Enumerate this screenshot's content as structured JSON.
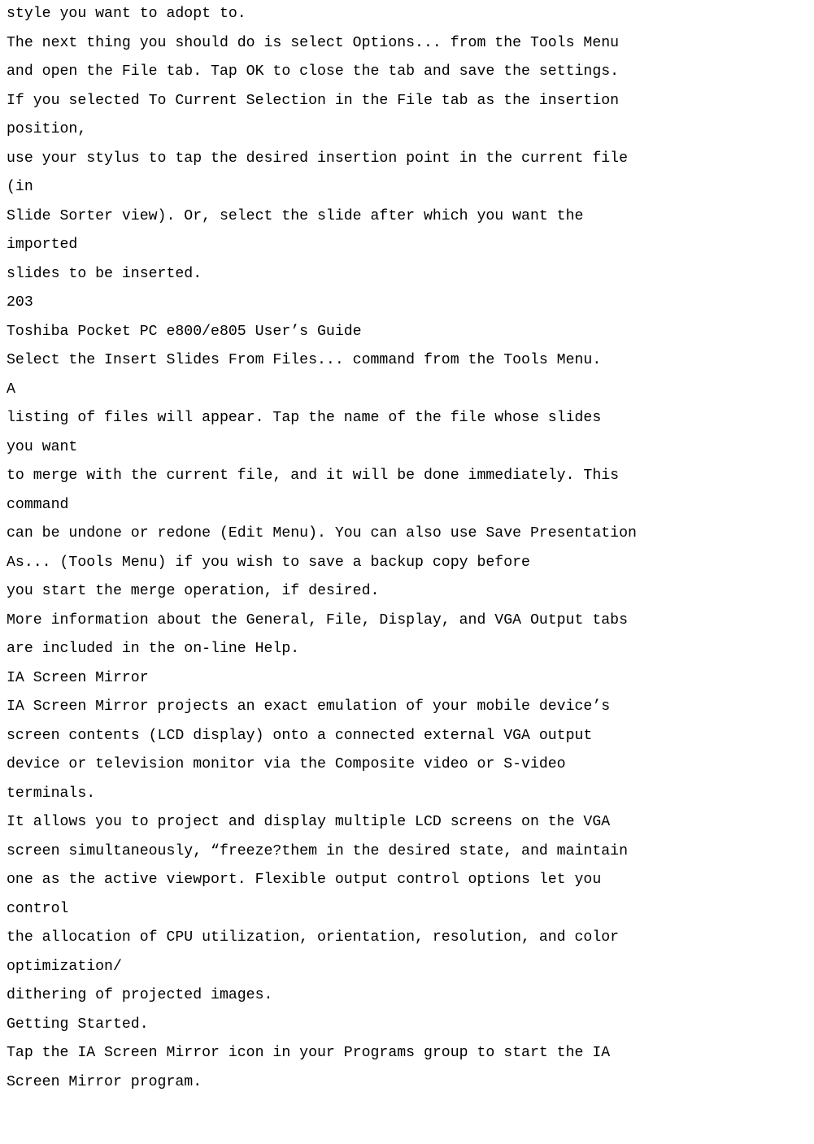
{
  "lines": [
    "style you want to adopt to.",
    "The next thing you should do is select Options... from the Tools Menu",
    "and open the File tab. Tap OK to close the tab and save the settings.",
    "If you selected To Current Selection in the File tab as the insertion",
    "position,",
    "use your stylus to tap the desired insertion point in the current file",
    "(in",
    "Slide Sorter view). Or, select the slide after which you want the",
    "imported",
    "slides to be inserted.",
    "203",
    "Toshiba Pocket PC e800/e805 User’s Guide",
    "Select the Insert Slides From Files... command from the Tools Menu.",
    "A",
    "listing of files will appear. Tap the name of the file whose slides",
    "you want",
    "to merge with the current file, and it will be done immediately. This",
    "command",
    "can be undone or redone (Edit Menu). You can also use Save Presentation",
    "As... (Tools Menu) if you wish to save a backup copy before",
    "you start the merge operation, if desired.",
    "More information about the General, File, Display, and VGA Output tabs",
    "are included in the on-line Help.",
    "IA Screen Mirror",
    "IA Screen Mirror projects an exact emulation of your mobile device’s",
    "screen contents (LCD display) onto a connected external VGA output",
    "device or television monitor via the Composite video or S-video",
    "terminals.",
    "It allows you to project and display multiple LCD screens on the VGA",
    "screen simultaneously, “freeze?them in the desired state, and maintain",
    "one as the active viewport. Flexible output control options let you",
    "control",
    "the allocation of CPU utilization, orientation, resolution, and color",
    "optimization/",
    "dithering of projected images.",
    "Getting Started.",
    "Tap the IA Screen Mirror icon in your Programs group to start the IA",
    "Screen Mirror program."
  ]
}
